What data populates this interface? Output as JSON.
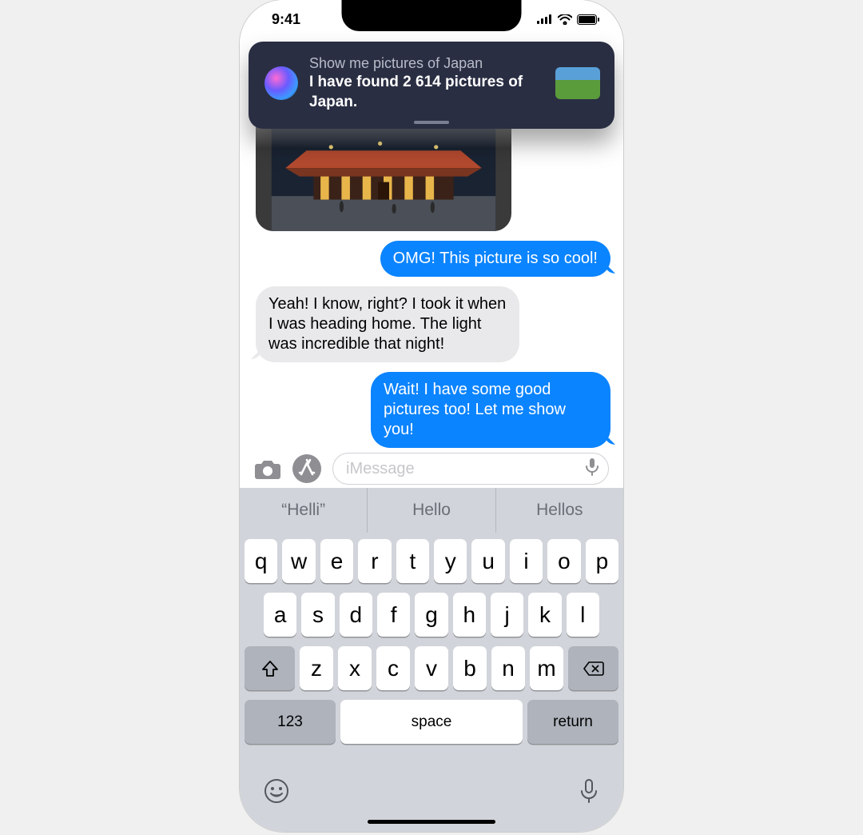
{
  "statusbar": {
    "time": "9:41"
  },
  "siri": {
    "query": "Show me pictures of Japan",
    "response": "I have found 2 614 pictures of Japan."
  },
  "messages": [
    {
      "kind": "image",
      "from": "them",
      "alt": "Illuminated Japanese temple at night"
    },
    {
      "kind": "text",
      "from": "me",
      "text": "OMG! This picture is so cool!"
    },
    {
      "kind": "text",
      "from": "them",
      "text": "Yeah! I know, right? I took it when I was heading home. The light was incredible that night!"
    },
    {
      "kind": "text",
      "from": "me",
      "text": "Wait! I have some good pictures too! Let me show you!"
    }
  ],
  "compose": {
    "placeholder": "iMessage"
  },
  "suggestions": [
    "“Helli”",
    "Hello",
    "Hellos"
  ],
  "keyboard": {
    "row1": [
      "q",
      "w",
      "e",
      "r",
      "t",
      "y",
      "u",
      "i",
      "o",
      "p"
    ],
    "row2": [
      "a",
      "s",
      "d",
      "f",
      "g",
      "h",
      "j",
      "k",
      "l"
    ],
    "row3": [
      "z",
      "x",
      "c",
      "v",
      "b",
      "n",
      "m"
    ],
    "numbers_label": "123",
    "space_label": "space",
    "return_label": "return"
  }
}
